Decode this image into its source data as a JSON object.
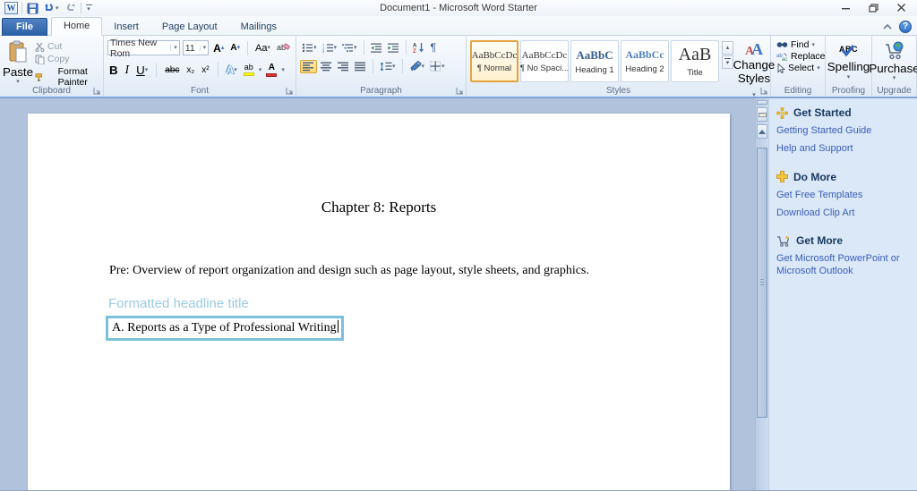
{
  "window": {
    "title": "Document1  -  Microsoft Word Starter"
  },
  "glyphs": {
    "dropdown": "▾",
    "up": "▴",
    "help": "?"
  },
  "tabs": [
    {
      "label": "File"
    },
    {
      "label": "Home"
    },
    {
      "label": "Insert"
    },
    {
      "label": "Page Layout"
    },
    {
      "label": "Mailings"
    }
  ],
  "ribbon": {
    "clipboard": {
      "label": "Clipboard",
      "paste": "Paste",
      "cut": "Cut",
      "copy": "Copy",
      "format_painter": "Format Painter"
    },
    "font": {
      "label": "Font",
      "family": "Times New Rom",
      "size": "11",
      "bold": "B",
      "italic": "I",
      "underline": "U",
      "strikethrough": "abc",
      "subscript": "x₂",
      "superscript": "x²",
      "change_case": "Aa",
      "grow_sample": "A",
      "shrink_sample": "A",
      "effects_sample": "A",
      "highlight_sample": "ab",
      "font_color_sample": "A"
    },
    "paragraph": {
      "label": "Paragraph",
      "pilcrow": "¶",
      "sort_label": "AZ"
    },
    "styles": {
      "label": "Styles",
      "change_line1": "Change",
      "change_line2": "Styles",
      "items": [
        {
          "sample": "AaBbCcDc",
          "name": "¶ Normal"
        },
        {
          "sample": "AaBbCcDc",
          "name": "¶ No Spaci..."
        },
        {
          "sample": "AaBbC",
          "name": "Heading 1"
        },
        {
          "sample": "AaBbCc",
          "name": "Heading 2"
        },
        {
          "sample": "AaB",
          "name": "Title"
        }
      ]
    },
    "editing": {
      "label": "Editing",
      "find": "Find",
      "replace": "Replace",
      "select": "Select"
    },
    "proofing": {
      "label": "Proofing",
      "abc": "ABC",
      "spelling": "Spelling"
    },
    "upgrade": {
      "label": "Upgrade",
      "purchase": "Purchase"
    }
  },
  "document": {
    "title": "Chapter 8: Reports",
    "body": "Pre: Overview of report organization and design such as page layout, style sheets, and graphics.",
    "headline_label": "Formatted headline title",
    "boxed_text": "A. Reports as a Type of Professional Writing"
  },
  "taskpane": {
    "sections": [
      {
        "heading": "Get Started",
        "icon": "starburst-icon",
        "links": [
          "Getting Started Guide",
          "Help and Support"
        ]
      },
      {
        "heading": "Do More",
        "icon": "plus-icon",
        "links": [
          "Get Free Templates",
          "Download Clip Art"
        ]
      },
      {
        "heading": "Get More",
        "icon": "cart-icon",
        "links": [
          "Get Microsoft PowerPoint or Microsoft Outlook"
        ]
      }
    ]
  },
  "colors": {
    "selection_orange": "#f5c35c",
    "file_tab_blue": "#2e60a5",
    "link_blue": "#3a5dbc",
    "section_heading": "#17375e",
    "headline_blue": "#9acbe3",
    "box_border": "#7cc1da",
    "heading1_blue": "#365f91",
    "heading2_blue": "#4f81bd",
    "canvas_blue": "#b1c3dc",
    "highlight_yellow": "#ffff00",
    "font_color_red": "#d43c3c"
  }
}
